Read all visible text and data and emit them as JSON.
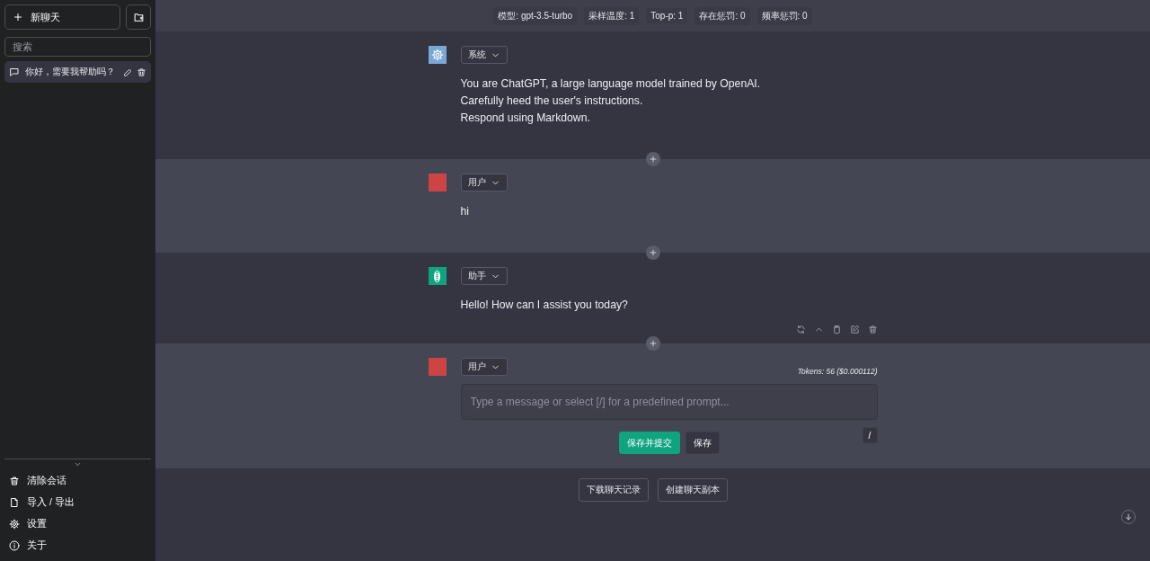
{
  "sidebar": {
    "new_chat": "新聊天",
    "search": {
      "placeholder": "搜索"
    },
    "chats": [
      {
        "title": "你好，需要我帮助吗？",
        "selected": true
      }
    ],
    "menu": [
      {
        "kind": "trash",
        "label": "清除会话"
      },
      {
        "kind": "file",
        "label": "导入 / 导出"
      },
      {
        "kind": "gear",
        "label": "设置"
      },
      {
        "kind": "info",
        "label": "关于"
      }
    ]
  },
  "config_bar": [
    "模型: gpt-3.5-turbo",
    "采样温度: 1",
    "Top-p: 1",
    "存在惩罚: 0",
    "频率惩罚: 0"
  ],
  "messages": [
    {
      "kind": "system",
      "role": "系统",
      "lines": [
        "You are ChatGPT, a large language model trained by OpenAI.",
        "Carefully heed the user's instructions.",
        "Respond using Markdown."
      ],
      "actions": false
    },
    {
      "kind": "user",
      "role": "用户",
      "lines": [
        "hi"
      ],
      "actions": false
    },
    {
      "kind": "assistant",
      "role": "助手",
      "lines": [
        "Hello! How can I assist you today?"
      ],
      "actions": true
    }
  ],
  "editor": {
    "kind": "user",
    "role": "用户",
    "tokens": "Tokens: 56 ($0.000112)",
    "placeholder": "Type a message or select [/] for a predefined prompt...",
    "prompt_key": "/",
    "buttons": [
      {
        "label": "保存并提交",
        "primary": true
      },
      {
        "label": "保存",
        "primary": false
      }
    ]
  },
  "footer_buttons": [
    "下载聊天记录",
    "创建聊天副本"
  ]
}
